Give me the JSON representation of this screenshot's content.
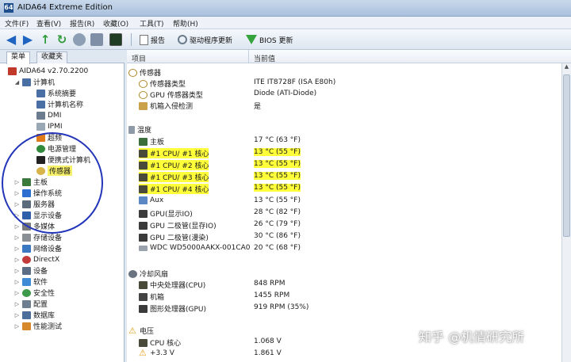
{
  "window": {
    "title": "AIDA64 Extreme Edition",
    "app_icon_glyph": "64"
  },
  "menu": [
    "文件(F)",
    "查看(V)",
    "报告(R)",
    "收藏(O)",
    "工具(T)",
    "帮助(H)"
  ],
  "toolbar": {
    "report_label": "报告",
    "driver_update_label": "驱动程序更新",
    "bios_update_label": "BIOS 更新"
  },
  "left_tabs": [
    "菜单",
    "收藏夹"
  ],
  "tree": {
    "root": "AIDA64 v2.70.2200",
    "computer": "计算机",
    "computer_children": [
      "系统摘要",
      "计算机名称",
      "DMI",
      "IPMI",
      "超频",
      "电源管理",
      "便携式计算机",
      "传感器"
    ],
    "top_items": [
      "主板",
      "操作系统",
      "服务器",
      "显示设备",
      "多媒体",
      "存储设备",
      "网络设备",
      "DirectX",
      "设备",
      "软件",
      "安全性",
      "配置",
      "数据库",
      "性能测试"
    ]
  },
  "columns": {
    "item": "项目",
    "value": "当前值"
  },
  "sections": {
    "sensor": {
      "title": "传感器",
      "rows": [
        {
          "label": "传感器类型",
          "value": "ITE IT8728F  (ISA E80h)"
        },
        {
          "label": "GPU 传感器类型",
          "value": "Diode  (ATI-Diode)"
        },
        {
          "label": "机箱入侵检测",
          "value": "是"
        }
      ]
    },
    "temperature": {
      "title": "温度",
      "rows": [
        {
          "label": "主板",
          "value": "17 °C  (63 °F)"
        },
        {
          "label": "#1 CPU/ #1 核心",
          "value": "13 °C  (55 °F)"
        },
        {
          "label": "#1 CPU/ #2 核心",
          "value": "13 °C  (55 °F)"
        },
        {
          "label": "#1 CPU/ #3 核心",
          "value": "13 °C  (55 °F)"
        },
        {
          "label": "#1 CPU/ #4 核心",
          "value": "13 °C  (55 °F)"
        },
        {
          "label": "Aux",
          "value": "13 °C  (55 °F)"
        },
        {
          "label": "GPU(显示IO)",
          "value": "28 °C  (82 °F)"
        },
        {
          "label": "GPU 二极管(显存IO)",
          "value": "26 °C  (79 °F)"
        },
        {
          "label": "GPU 二极管(漫染)",
          "value": "30 °C  (86 °F)"
        },
        {
          "label": "WDC WD5000AAKX-001CA0",
          "value": "20 °C  (68 °F)"
        }
      ]
    },
    "fans": {
      "title": "冷却风扇",
      "rows": [
        {
          "label": "中央处理器(CPU)",
          "value": "848 RPM"
        },
        {
          "label": "机箱",
          "value": "1455 RPM"
        },
        {
          "label": "图形处理器(GPU)",
          "value": "919 RPM  (35%)"
        }
      ]
    },
    "voltage": {
      "title": "电压",
      "rows": [
        {
          "label": "CPU 核心",
          "value": "1.068 V"
        },
        {
          "label": "+3.3 V",
          "value": "1.861 V"
        }
      ]
    }
  },
  "watermark": "知乎 @机情研究所",
  "colors": {
    "highlight": "#ffff3a",
    "annotation": "#2336b9",
    "toolbar_arrow": "#1f64c0"
  }
}
